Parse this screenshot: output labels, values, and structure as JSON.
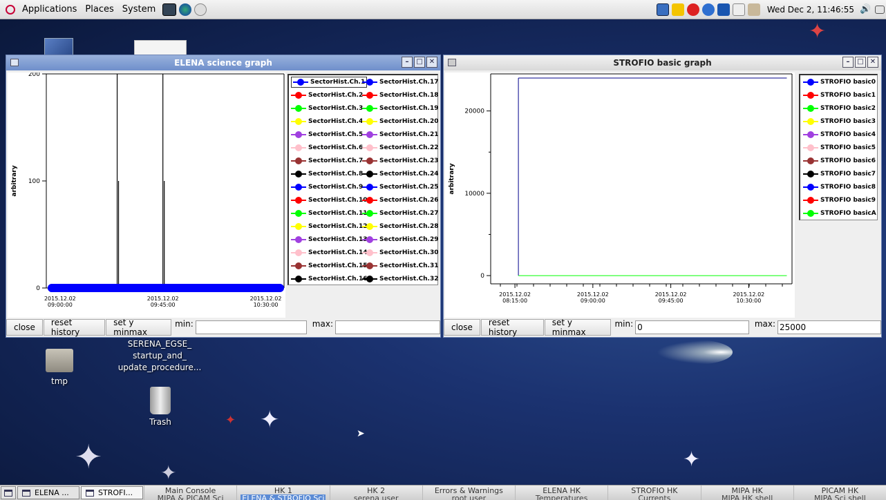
{
  "panel": {
    "menu": [
      "Applications",
      "Places",
      "System"
    ],
    "clock": "Wed Dec  2, 11:46:55"
  },
  "desktop": {
    "icons": [
      {
        "label": "tmp"
      },
      {
        "label": "SERENA_EGSE_ startup_and_ update_procedure..."
      },
      {
        "label": "Trash"
      }
    ]
  },
  "win1": {
    "title": "ELENA science graph",
    "controls": {
      "close": "close",
      "reset": "reset history",
      "setminmax": "set y minmax",
      "min_label": "min:",
      "min_value": "",
      "max_label": "max:",
      "max_value": ""
    }
  },
  "win2": {
    "title": "STROFIO basic graph",
    "controls": {
      "close": "close",
      "reset": "reset history",
      "setminmax": "set y minmax",
      "min_label": "min:",
      "min_value": "0",
      "max_label": "max:",
      "max_value": "25000"
    }
  },
  "chart_data": [
    {
      "type": "line",
      "ylabel": "arbitrary",
      "ylim": [
        0,
        200
      ],
      "yticks": [
        "0",
        "100",
        "200"
      ],
      "xticks": [
        "2015.12.02\n09:00:00",
        "2015.12.02\n09:45:00",
        "2015.12.02\n10:30:00"
      ],
      "x": [
        "08:54",
        "09:05",
        "09:15",
        "09:25",
        "09:35",
        "09:45",
        "09:55",
        "10:05",
        "10:15",
        "10:25",
        "10:35"
      ],
      "baseline": {
        "name": "SectorHist.Ch.1",
        "values": [
          0,
          0,
          0,
          0,
          0,
          0,
          0,
          0,
          0,
          0,
          0
        ]
      },
      "spikes": [
        {
          "x": "09:25",
          "values": [
            0,
            100,
            200
          ]
        },
        {
          "x": "09:45",
          "values": [
            0,
            100,
            200
          ]
        }
      ],
      "legend": [
        {
          "name": "SectorHist.Ch.1",
          "color": "#0000ff"
        },
        {
          "name": "SectorHist.Ch.17",
          "color": "#0000ff"
        },
        {
          "name": "SectorHist.Ch.2",
          "color": "#ff0000"
        },
        {
          "name": "SectorHist.Ch.18",
          "color": "#ff0000"
        },
        {
          "name": "SectorHist.Ch.3",
          "color": "#00ff00"
        },
        {
          "name": "SectorHist.Ch.19",
          "color": "#00ff00"
        },
        {
          "name": "SectorHist.Ch.4",
          "color": "#ffff00"
        },
        {
          "name": "SectorHist.Ch.20",
          "color": "#ffff00"
        },
        {
          "name": "SectorHist.Ch.5",
          "color": "#a040e0"
        },
        {
          "name": "SectorHist.Ch.21",
          "color": "#a040e0"
        },
        {
          "name": "SectorHist.Ch.6",
          "color": "#ffc0cb"
        },
        {
          "name": "SectorHist.Ch.22",
          "color": "#ffc0cb"
        },
        {
          "name": "SectorHist.Ch.7",
          "color": "#993333"
        },
        {
          "name": "SectorHist.Ch.23",
          "color": "#993333"
        },
        {
          "name": "SectorHist.Ch.8",
          "color": "#000000"
        },
        {
          "name": "SectorHist.Ch.24",
          "color": "#000000"
        },
        {
          "name": "SectorHist.Ch.9",
          "color": "#0000ff"
        },
        {
          "name": "SectorHist.Ch.25",
          "color": "#0000ff"
        },
        {
          "name": "SectorHist.Ch.10",
          "color": "#ff0000"
        },
        {
          "name": "SectorHist.Ch.26",
          "color": "#ff0000"
        },
        {
          "name": "SectorHist.Ch.11",
          "color": "#00ff00"
        },
        {
          "name": "SectorHist.Ch.27",
          "color": "#00ff00"
        },
        {
          "name": "SectorHist.Ch.12",
          "color": "#ffff00"
        },
        {
          "name": "SectorHist.Ch.28",
          "color": "#ffff00"
        },
        {
          "name": "SectorHist.Ch.13",
          "color": "#a040e0"
        },
        {
          "name": "SectorHist.Ch.29",
          "color": "#a040e0"
        },
        {
          "name": "SectorHist.Ch.14",
          "color": "#ffc0cb"
        },
        {
          "name": "SectorHist.Ch.30",
          "color": "#ffc0cb"
        },
        {
          "name": "SectorHist.Ch.15",
          "color": "#993333"
        },
        {
          "name": "SectorHist.Ch.31",
          "color": "#993333"
        },
        {
          "name": "SectorHist.Ch.16",
          "color": "#000000"
        },
        {
          "name": "SectorHist.Ch.32",
          "color": "#000000"
        }
      ]
    },
    {
      "type": "line",
      "ylabel": "arbitrary",
      "ylim": [
        -1000,
        24500
      ],
      "yticks": [
        "0",
        "10000",
        "20000"
      ],
      "xticks": [
        "2015.12.02\n08:15:00",
        "2015.12.02\n09:00:00",
        "2015.12.02\n09:45:00",
        "2015.12.02\n10:30:00"
      ],
      "series": [
        {
          "name": "STROFIO basic0",
          "color": "#00008b",
          "x": [
            "08:17",
            "10:52"
          ],
          "values": [
            24000,
            24000
          ]
        },
        {
          "name": "STROFIO basicA",
          "color": "#00ff00",
          "x": [
            "08:17",
            "10:52"
          ],
          "values": [
            0,
            0
          ]
        }
      ],
      "legend": [
        {
          "name": "STROFIO basic0",
          "color": "#0000ff"
        },
        {
          "name": "STROFIO basic1",
          "color": "#ff0000"
        },
        {
          "name": "STROFIO basic2",
          "color": "#00ff00"
        },
        {
          "name": "STROFIO basic3",
          "color": "#ffff00"
        },
        {
          "name": "STROFIO basic4",
          "color": "#a040e0"
        },
        {
          "name": "STROFIO basic5",
          "color": "#ffc0cb"
        },
        {
          "name": "STROFIO basic6",
          "color": "#993333"
        },
        {
          "name": "STROFIO basic7",
          "color": "#000000"
        },
        {
          "name": "STROFIO basic8",
          "color": "#0000ff"
        },
        {
          "name": "STROFIO basic9",
          "color": "#ff0000"
        },
        {
          "name": "STROFIO basicA",
          "color": "#00ff00"
        }
      ]
    }
  ],
  "taskbar": {
    "windows": [
      {
        "label": "ELENA ..."
      },
      {
        "label": "STROFI..."
      }
    ],
    "workspaces": [
      {
        "l1": "Main Console",
        "l2": "MIPA & PICAM Sci"
      },
      {
        "l1": "HK 1",
        "l2": "ELENA & STROFIO Sci"
      },
      {
        "l1": "HK 2",
        "l2": "serena user"
      },
      {
        "l1": "Errors & Warnings",
        "l2": "root user"
      },
      {
        "l1": "ELENA HK",
        "l2": "Temperatures"
      },
      {
        "l1": "STROFIO HK",
        "l2": "Currents"
      },
      {
        "l1": "MIPA HK",
        "l2": "MIPA HK shell"
      },
      {
        "l1": "PICAM HK",
        "l2": "MIPA Sci shell"
      }
    ]
  }
}
